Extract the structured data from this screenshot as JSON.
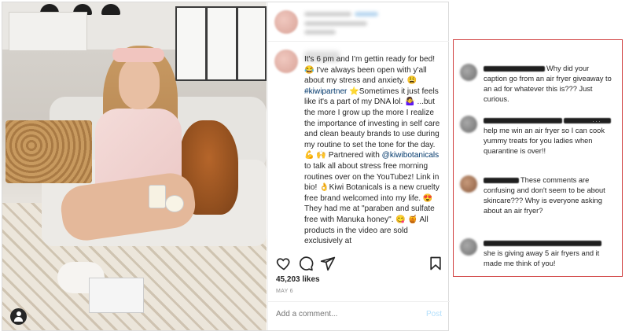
{
  "post": {
    "caption_parts": {
      "p1": "It's 6 pm and I'm gettin ready for bed! 😂 I've always been open with y'all about my stress and anxiety. 😩 ",
      "tag1": "#kiwipartner",
      "p2": " ⭐Sometimes it just feels like it's a part of my DNA lol. 🤷‍♀️ ...but the more I grow up the more I realize the importance of investing in self care and clean beauty brands to use during my routine to set the tone for the day. 💪 🙌 Partnered with ",
      "tag2": "@kiwibotanicals",
      "p3": " to talk all about stress free morning routines over on the YouTubez! Link in bio! 👌Kiwi Botanicals is a new cruelty free brand welcomed into my life. 😍 They had me at \"paraben and sulfate free with Manuka honey\". 😋 🍯 All products in the video are sold exclusively at"
    },
    "likes": "45,203 likes",
    "date": "MAY 6",
    "comment_placeholder": "Add a comment...",
    "post_label": "Post",
    "icons": [
      "heart-icon",
      "comment-icon",
      "share-icon",
      "bookmark-icon",
      "account-icon"
    ]
  },
  "comments": [
    {
      "text": "Why did your caption go from an air fryer giveaway to an ad for whatever this is??? Just curious."
    },
    {
      "text": "help me win an air fryer so I can cook yummy treats for you ladies when quarantine is over!!"
    },
    {
      "text": "These comments are confusing and don't seem to be about skincare??? Why is everyone asking about an air fryer?"
    },
    {
      "text": "she is giving away 5 air fryers and it made me think of you!"
    }
  ],
  "colors": {
    "border_red": "#d04040",
    "link": "#00376b",
    "muted": "#8e8e8e",
    "post_btn": "#b2dffc"
  }
}
